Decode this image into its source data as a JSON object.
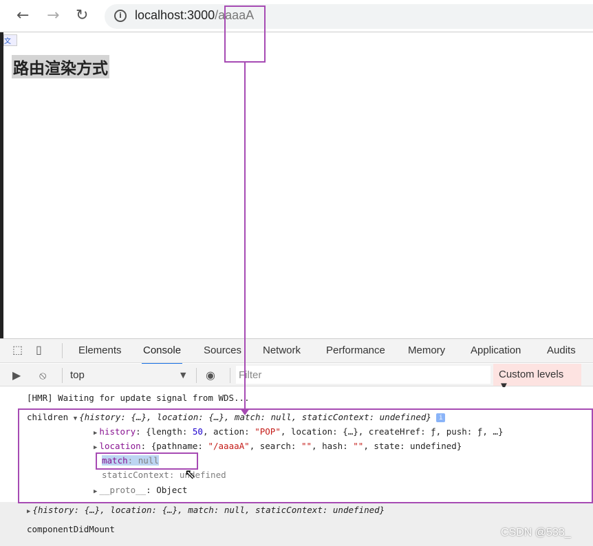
{
  "browser": {
    "url_host": "localhost:3000",
    "url_path": "/aaaaA",
    "back_icon": "arrow-left-icon",
    "forward_icon": "arrow-right-icon",
    "reload_icon": "reload-icon",
    "info_icon": "info-icon"
  },
  "page": {
    "heading": "路由渲染方式"
  },
  "devtools": {
    "tabs": [
      "Elements",
      "Console",
      "Sources",
      "Network",
      "Performance",
      "Memory",
      "Application",
      "Audits"
    ],
    "active_tab": "Console",
    "context": "top",
    "filter_placeholder": "Filter",
    "levels": "Custom levels ▼"
  },
  "console": {
    "hmr": "[HMR] Waiting for update signal from WDS...",
    "children_label": "children ",
    "summary": "{history: {…}, location: {…}, match: null, staticContext: undefined}",
    "history_key": "history",
    "history_val_a": ": {length: ",
    "history_len": "50",
    "history_val_b": ", action: ",
    "history_action": "\"POP\"",
    "history_val_c": ", location: {…}, createHref: ƒ, push: ƒ, …}",
    "location_key": "location",
    "location_val_a": ": {pathname: ",
    "location_path": "\"/aaaaA\"",
    "location_val_b": ", search: ",
    "location_search": "\"\"",
    "location_val_c": ", hash: ",
    "location_hash": "\"\"",
    "location_val_d": ", state: undefined}",
    "match_key": "match",
    "match_val": ": null",
    "static_key": "staticContext",
    "static_val": ": undefined",
    "proto_key": "__proto__",
    "proto_val": ": Object",
    "summary2": "{history: {…}, location: {…}, match: null, staticContext: undefined}",
    "did_mount": "componentDidMount"
  },
  "watermark": "CSDN @533_",
  "colors": {
    "annotation": "#a64ab3",
    "accent": "#1a73e8"
  }
}
